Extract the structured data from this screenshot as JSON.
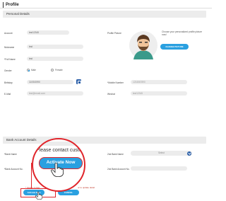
{
  "header": {
    "title": "Profile"
  },
  "sections": {
    "personal": "Personal Details",
    "bank": "Bank Account Details"
  },
  "personal": {
    "account": {
      "label": "Account",
      "value": "test12345"
    },
    "nickname": {
      "label": "Nickname",
      "value": "test"
    },
    "fullname": {
      "label": "*Full Name",
      "value": "test"
    },
    "gender": {
      "label": "Gender",
      "options": [
        "Male",
        "Female"
      ],
      "selected": "Male"
    },
    "birthday": {
      "label": "Birthday",
      "value": "11/05/1990"
    },
    "email": {
      "label": "E-Mail",
      "value": "test@email.com"
    },
    "mobile": {
      "label": "*Mobile Number",
      "value": "1234567890"
    },
    "wechat": {
      "label": "Wechat",
      "value": "test12345"
    },
    "picture": {
      "label": "Profile Picture",
      "hint": "Choose your personalized profile picture now!",
      "change_button": "CHANGE PICTURE"
    }
  },
  "bank": {
    "bank_name": {
      "label": "*Bank Name"
    },
    "account_no": {
      "label": "*Bank Account No."
    },
    "bank2_name": {
      "label": "2nd Bank Name",
      "selected": "Select"
    },
    "bank2_account": {
      "label": "2nd Bank Account No."
    },
    "note_left": "* please contac",
    "note_right": "ur to update detail",
    "activate_button": "Activate Now",
    "cancel_button": "CANCEL"
  },
  "zoom": {
    "text": "Please contact custo",
    "button": "Activate Now"
  },
  "colors": {
    "accent": "#2aa0e0",
    "dark_accent": "#2b5fa8",
    "highlight": "#e0242a",
    "field_bg": "#ececec"
  }
}
